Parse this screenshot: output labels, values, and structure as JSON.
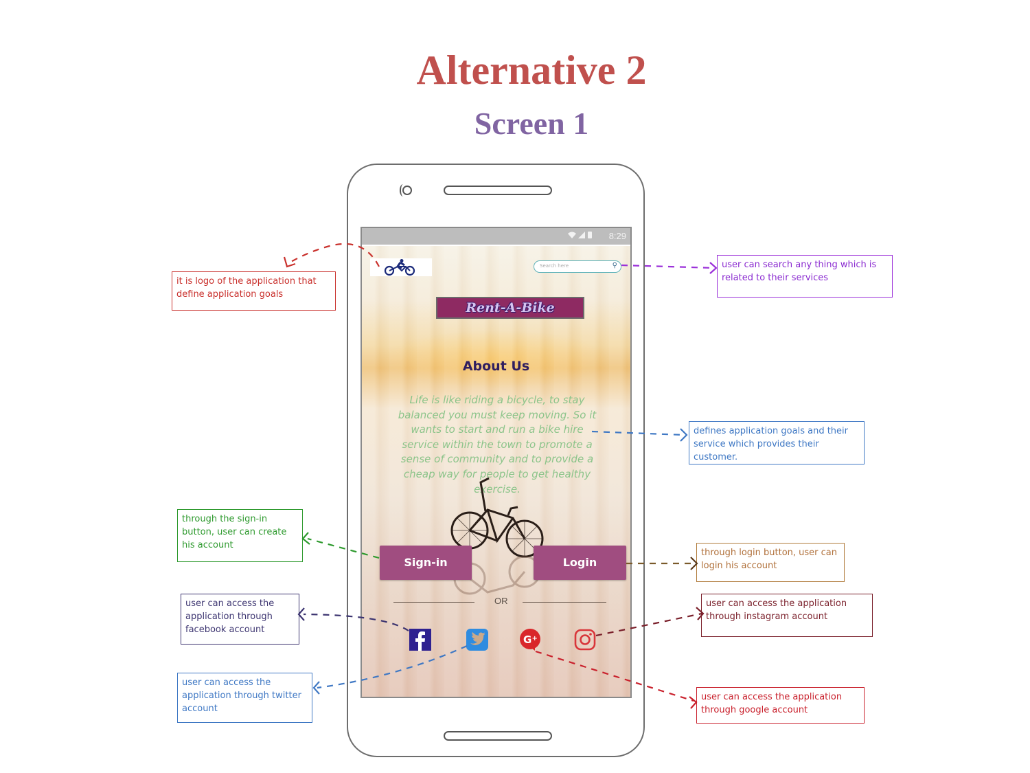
{
  "header": {
    "title": "Alternative 2",
    "subtitle": "Screen 1"
  },
  "colors": {
    "title": "#c0504d",
    "subtitle": "#8064a2",
    "button": "#a04d80",
    "brand_banner": "#8e2a62"
  },
  "phone": {
    "statusbar": {
      "icons": "wifi-signal-battery",
      "time": "8:29"
    },
    "app": {
      "logo_icon": "cyclist-icon",
      "search_placeholder": "Search here",
      "brand": "Rent-A-Bike",
      "about_title": "About Us",
      "about_text": "Life is like riding a bicycle, to stay balanced you must keep moving. So it  wants to start and run a bike hire service within the town to promote a sense of community and to provide a cheap way for people to get healthy exercise.",
      "signin_label": "Sign-in",
      "login_label": "Login",
      "or_label": "OR",
      "social": [
        {
          "name": "facebook",
          "icon": "facebook-icon"
        },
        {
          "name": "twitter",
          "icon": "twitter-icon"
        },
        {
          "name": "google-plus",
          "icon": "google-plus-icon"
        },
        {
          "name": "instagram",
          "icon": "instagram-icon"
        }
      ]
    }
  },
  "callouts": {
    "logo": {
      "text": " it is logo of the application that define application goals",
      "color": "#c9302c"
    },
    "search": {
      "text": "user can search any thing which is related to their services",
      "color": "#9b30d9"
    },
    "about": {
      "text": "defines application goals and their service which provides their customer.",
      "color": "#3f78c4"
    },
    "signin": {
      "text": "through the sign-in button, user can create his account",
      "color": "#2e9a2e"
    },
    "login": {
      "text": "through login  button, user can  login his account",
      "color": "#b07a3a"
    },
    "facebook": {
      "text": "user can access the application through facebook account",
      "color": "#3c3470"
    },
    "instagram": {
      "text": "user can access the application through instagram account",
      "color": "#7a1f2a"
    },
    "twitter": {
      "text": "user can access the application through twitter account",
      "color": "#3f78c4"
    },
    "google": {
      "text": "user can access the application through google account",
      "color": "#c9202c"
    }
  }
}
